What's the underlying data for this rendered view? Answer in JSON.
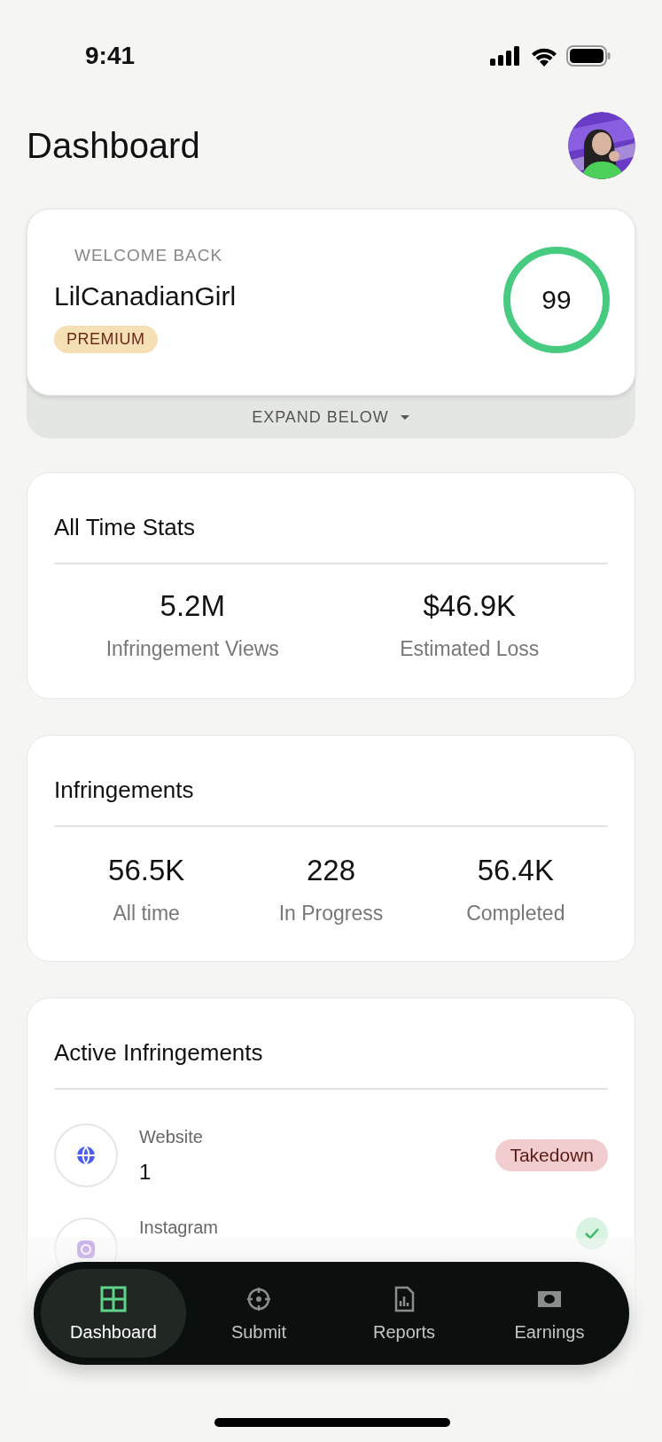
{
  "status_bar": {
    "time": "9:41"
  },
  "header": {
    "title": "Dashboard"
  },
  "welcome": {
    "eyebrow": "WELCOME BACK",
    "username": "LilCanadianGirl",
    "plan": "PREMIUM",
    "score": "99",
    "expand_label": "EXPAND BELOW"
  },
  "all_time_stats": {
    "title": "All Time Stats",
    "stats": [
      {
        "value": "5.2M",
        "label": "Infringement Views"
      },
      {
        "value": "$46.9K",
        "label": "Estimated Loss"
      }
    ]
  },
  "infringements": {
    "title": "Infringements",
    "stats": [
      {
        "value": "56.5K",
        "label": "All time"
      },
      {
        "value": "228",
        "label": "In Progress"
      },
      {
        "value": "56.4K",
        "label": "Completed"
      }
    ]
  },
  "active_infringements": {
    "title": "Active Infringements",
    "items": [
      {
        "kind": "website",
        "platform": "Website",
        "count": "1",
        "status": "Takedown"
      },
      {
        "kind": "instagram",
        "platform": "Instagram"
      }
    ]
  },
  "tab_bar": [
    {
      "kind": "dashboard",
      "label": "Dashboard",
      "selected": true
    },
    {
      "kind": "submit",
      "label": "Submit",
      "selected": false
    },
    {
      "kind": "reports",
      "label": "Reports",
      "selected": false
    },
    {
      "kind": "earnings",
      "label": "Earnings",
      "selected": false
    }
  ]
}
